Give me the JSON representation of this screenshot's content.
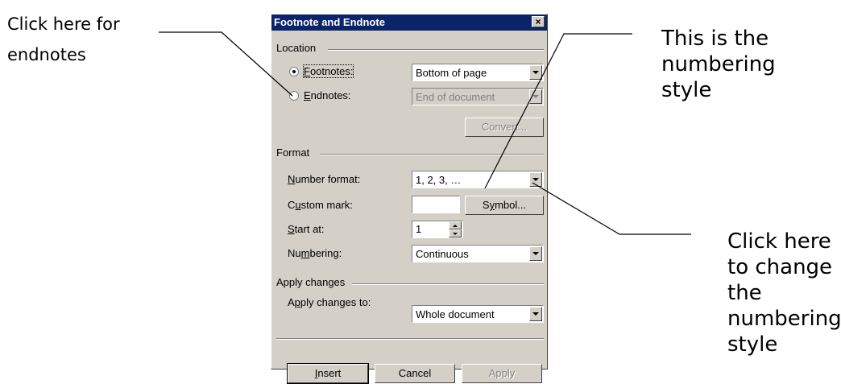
{
  "annotations": {
    "endnotes": [
      "Click here for",
      "endnotes"
    ],
    "numbering_style": [
      "This is the",
      "numbering",
      "style"
    ],
    "change_style": [
      "Click here",
      "to change",
      "the",
      "numbering",
      "style"
    ]
  },
  "dialog": {
    "title": "Footnote and Endnote",
    "close_glyph": "×",
    "location": {
      "label": "Location",
      "footnotes_label": "Footnotes:",
      "footnotes_value": "Bottom of page",
      "endnotes_label": "Endnotes:",
      "endnotes_value": "End of document",
      "convert_label": "Convert...",
      "selected": "footnotes"
    },
    "format": {
      "label": "Format",
      "number_format_label": "Number format:",
      "number_format_value": "1, 2, 3, …",
      "custom_mark_label": "Custom mark:",
      "custom_mark_value": "",
      "symbol_label": "Symbol...",
      "start_at_label": "Start at:",
      "start_at_value": "1",
      "numbering_label": "Numbering:",
      "numbering_value": "Continuous"
    },
    "apply_changes": {
      "label": "Apply changes",
      "apply_to_label": "Apply changes to:",
      "apply_to_value": "Whole document"
    },
    "buttons": {
      "insert": "Insert",
      "cancel": "Cancel",
      "apply": "Apply"
    }
  }
}
